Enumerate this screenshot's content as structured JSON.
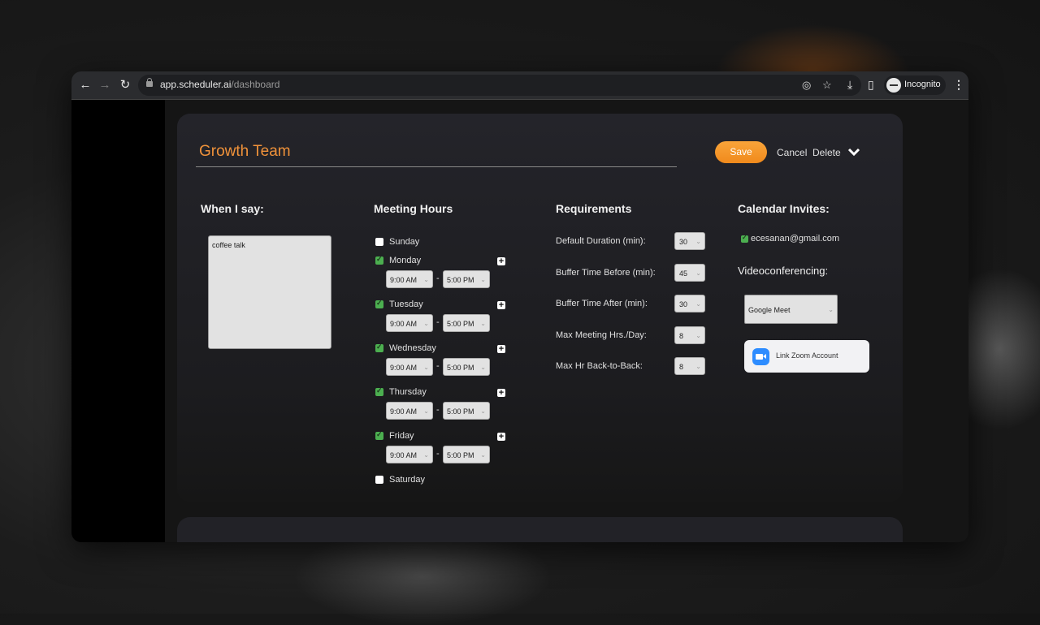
{
  "browser": {
    "url_host": "app.scheduler.ai",
    "url_path": "/dashboard",
    "profile_label": "Incognito"
  },
  "header": {
    "team_name": "Growth Team",
    "save_label": "Save",
    "cancel_label": "Cancel",
    "delete_label": "Delete"
  },
  "when_i_say": {
    "title": "When I say:",
    "value": "coffee talk"
  },
  "meeting_hours": {
    "title": "Meeting Hours",
    "days": [
      {
        "name": "Sunday",
        "checked": false
      },
      {
        "name": "Monday",
        "checked": true,
        "start": "9:00 AM",
        "end": "5:00 PM"
      },
      {
        "name": "Tuesday",
        "checked": true,
        "start": "9:00 AM",
        "end": "5:00 PM"
      },
      {
        "name": "Wednesday",
        "checked": true,
        "start": "9:00 AM",
        "end": "5:00 PM"
      },
      {
        "name": "Thursday",
        "checked": true,
        "start": "9:00 AM",
        "end": "5:00 PM"
      },
      {
        "name": "Friday",
        "checked": true,
        "start": "9:00 AM",
        "end": "5:00 PM"
      },
      {
        "name": "Saturday",
        "checked": false
      }
    ],
    "separator": "-"
  },
  "requirements": {
    "title": "Requirements",
    "items": [
      {
        "label": "Default Duration (min):",
        "value": "30"
      },
      {
        "label": "Buffer Time Before (min):",
        "value": "45"
      },
      {
        "label": "Buffer Time After (min):",
        "value": "30"
      },
      {
        "label": "Max Meeting Hrs./Day:",
        "value": "8"
      },
      {
        "label": "Max Hr Back-to-Back:",
        "value": "8"
      }
    ]
  },
  "calendar": {
    "title": "Calendar Invites:",
    "email": "ecesanan@gmail.com",
    "email_checked": true,
    "video_title": "Videoconferencing:",
    "video_provider": "Google Meet",
    "zoom_label": "Link Zoom Account"
  },
  "colors": {
    "accent": "#f0923a",
    "check": "#4caf50",
    "zoom_blue": "#2d8cff"
  }
}
